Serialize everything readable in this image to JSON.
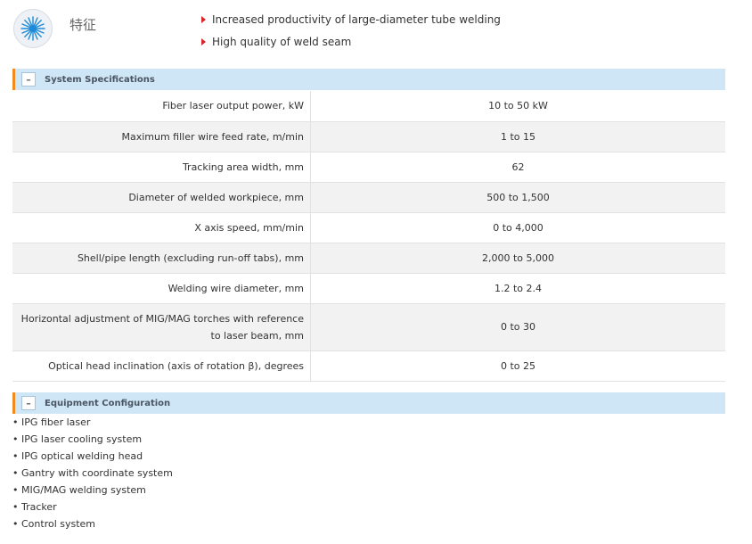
{
  "features": {
    "title": "特征",
    "items": [
      "Increased productivity of large-diameter tube welding",
      "High quality of weld seam"
    ]
  },
  "specs": {
    "section_title": "System Specifications",
    "toggle": "–",
    "rows": [
      {
        "param": "Fiber laser output power, kW",
        "value": "10 to 50 kW"
      },
      {
        "param": "Maximum filler wire feed rate, m/min",
        "value": "1 to 15"
      },
      {
        "param": "Tracking area width, mm",
        "value": "62"
      },
      {
        "param": "Diameter of welded workpiece, mm",
        "value": "500 to 1,500"
      },
      {
        "param": "X axis speed, mm/min",
        "value": "0 to 4,000"
      },
      {
        "param": "Shell/pipe length (excluding run-off tabs), mm",
        "value": "2,000 to 5,000"
      },
      {
        "param": "Welding wire diameter, mm",
        "value": "1.2 to 2.4"
      },
      {
        "param": "Horizontal adjustment of MIG/MAG torches with reference to laser beam, mm",
        "value": "0 to 30"
      },
      {
        "param": "Optical head inclination (axis of rotation β), degrees",
        "value": "0 to 25"
      }
    ]
  },
  "equipment": {
    "section_title": "Equipment Configuration",
    "toggle": "–",
    "items": [
      "IPG fiber laser",
      "IPG laser cooling system",
      "IPG optical welding head",
      "Gantry with coordinate system",
      "MIG/MAG welding system",
      "Tracker",
      "Control system"
    ]
  },
  "colors": {
    "accent": "#f28a1e",
    "section_bg": "#cfe6f6",
    "bullet_red": "#d8242b",
    "logo_blue": "#1e8bd8"
  },
  "icons": {
    "logo": "laser-burst-icon",
    "feature_bullet": "triangle-icon",
    "toggle": "collapse-icon"
  }
}
